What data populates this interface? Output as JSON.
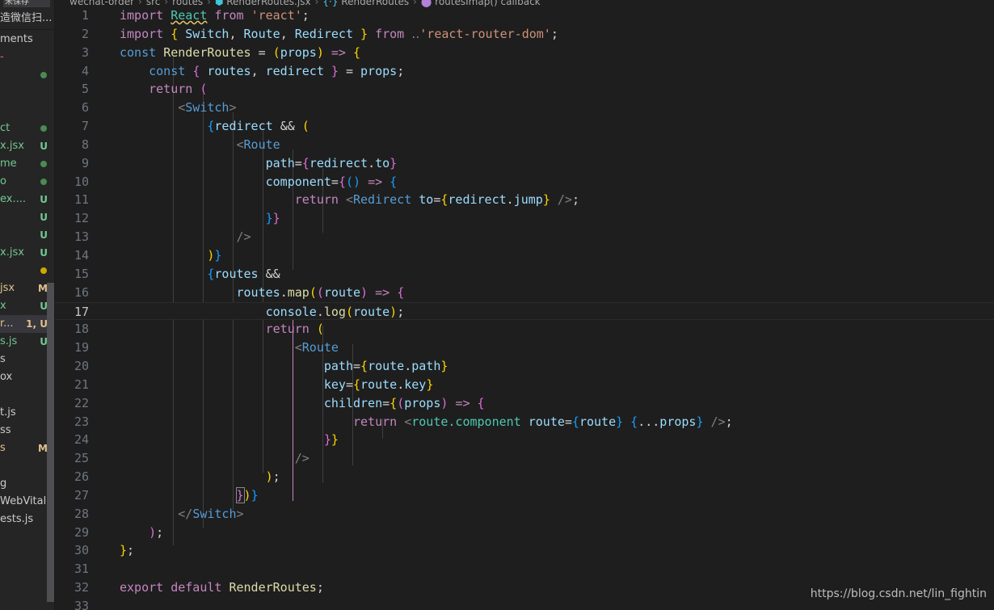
{
  "sidebar": {
    "tab_label": "未保存",
    "title": "造微信扫...",
    "scrollbar": "vertical-scrollbar",
    "items": [
      {
        "label": "ments",
        "badge": "",
        "badge_color": "",
        "dot": "",
        "selected": false
      },
      {
        "label": "-",
        "badge": "",
        "badge_color": "",
        "dot": "",
        "selected": false
      },
      {
        "label": "",
        "badge": "",
        "badge_color": "",
        "dot": "#4a8b52",
        "selected": false
      },
      {
        "label": "",
        "badge": "",
        "badge_color": "",
        "dot": "",
        "selected": false
      },
      {
        "label": "",
        "badge": "",
        "badge_color": "",
        "dot": "",
        "selected": false
      },
      {
        "label": "ct",
        "badge": "",
        "badge_color": "",
        "dot": "#4a8b52",
        "selected": false
      },
      {
        "label": "x.jsx",
        "badge": "U",
        "badge_color": "#73c991",
        "dot": "",
        "selected": false
      },
      {
        "label": "me",
        "badge": "",
        "badge_color": "",
        "dot": "#4a8b52",
        "selected": false
      },
      {
        "label": "o",
        "badge": "",
        "badge_color": "",
        "dot": "#4a8b52",
        "selected": false
      },
      {
        "label": "ex....",
        "badge": "U",
        "badge_color": "#73c991",
        "dot": "",
        "selected": false
      },
      {
        "label": "",
        "badge": "U",
        "badge_color": "#73c991",
        "dot": "",
        "selected": false
      },
      {
        "label": "",
        "badge": "U",
        "badge_color": "#73c991",
        "dot": "",
        "selected": false
      },
      {
        "label": "x.jsx",
        "badge": "U",
        "badge_color": "#73c991",
        "dot": "",
        "selected": false
      },
      {
        "label": "",
        "badge": "",
        "badge_color": "",
        "dot": "#cca700",
        "selected": false
      },
      {
        "label": "jsx",
        "badge": "M",
        "badge_color": "#e2c08d",
        "dot": "",
        "selected": false
      },
      {
        "label": "x",
        "badge": "U",
        "badge_color": "#73c991",
        "dot": "",
        "selected": false
      },
      {
        "label": "r...",
        "badge": "1, U",
        "badge_color": "#e2c08d",
        "dot": "",
        "selected": true
      },
      {
        "label": "s.js",
        "badge": "U",
        "badge_color": "#73c991",
        "dot": "",
        "selected": false
      },
      {
        "label": "s",
        "badge": "",
        "badge_color": "",
        "dot": "",
        "selected": false
      },
      {
        "label": "ox",
        "badge": "",
        "badge_color": "",
        "dot": "",
        "selected": false
      },
      {
        "label": "",
        "badge": "",
        "badge_color": "",
        "dot": "",
        "selected": false
      },
      {
        "label": "t.js",
        "badge": "",
        "badge_color": "",
        "dot": "",
        "selected": false
      },
      {
        "label": "ss",
        "badge": "",
        "badge_color": "",
        "dot": "",
        "selected": false
      },
      {
        "label": "s",
        "badge": "M",
        "badge_color": "#e2c08d",
        "dot": "",
        "selected": false
      },
      {
        "label": "",
        "badge": "",
        "badge_color": "",
        "dot": "",
        "selected": false
      },
      {
        "label": "g",
        "badge": "",
        "badge_color": "",
        "dot": "",
        "selected": false
      },
      {
        "label": "WebVital...",
        "badge": "",
        "badge_color": "",
        "dot": "",
        "selected": false
      },
      {
        "label": "ests.js",
        "badge": "",
        "badge_color": "",
        "dot": "",
        "selected": false
      }
    ]
  },
  "breadcrumb": {
    "crumbs": [
      "wechat-order",
      "src",
      "routes",
      "RenderRoutes.jsx",
      "RenderRoutes",
      "routesImap() callback"
    ],
    "separator": "›"
  },
  "editor": {
    "active_line": 17,
    "total_lines_visible": 33,
    "line_numbers": [
      1,
      2,
      3,
      4,
      5,
      6,
      7,
      8,
      9,
      10,
      11,
      12,
      13,
      14,
      15,
      16,
      17,
      18,
      19,
      20,
      21,
      22,
      23,
      24,
      25,
      26,
      27,
      28,
      29,
      30,
      31,
      32,
      33
    ],
    "code_lines": [
      "import React from 'react';",
      "import { Switch, Route, Redirect } from 'react-router-dom';",
      "const RenderRoutes = (props) => {",
      "    const { routes, redirect } = props;",
      "    return (",
      "        <Switch>",
      "            {redirect && (",
      "                <Route",
      "                    path={redirect.to}",
      "                    component={() => {",
      "                        return <Redirect to={redirect.jump} />;",
      "                    }}",
      "                />",
      "            )}",
      "            {routes &&",
      "                routes.map((route) => {",
      "                    console.log(route);",
      "                    return (",
      "                        <Route",
      "                            path={route.path}",
      "                            key={route.key}",
      "                            children={(props) => {",
      "                                return <route.component route={route} {...props} />;",
      "                            }}",
      "                        />",
      "                    );",
      "                })}",
      "        </Switch>",
      "    );",
      "};",
      "",
      "export default RenderRoutes;",
      ""
    ],
    "filename": "RenderRoutes.jsx",
    "language": "javascriptreact"
  },
  "watermark": {
    "text": "https://blog.csdn.net/lin_fightin"
  },
  "colors": {
    "editor_bg": "#1e1e1e",
    "sidebar_bg": "#252526",
    "selection_bg": "#37373d",
    "line_number": "#6e7681",
    "active_line_number": "#c6c6c6",
    "keyword": "#c586c0",
    "keyword_const": "#569cd6",
    "identifier": "#9cdcfe",
    "string": "#ce9178",
    "class_name": "#4ec9b0",
    "function": "#dcdcaa",
    "bracket_yellow": "#ffd700",
    "bracket_pink": "#da70d6",
    "bracket_blue": "#179fff",
    "untracked": "#73c991",
    "modified": "#e2c08d"
  }
}
